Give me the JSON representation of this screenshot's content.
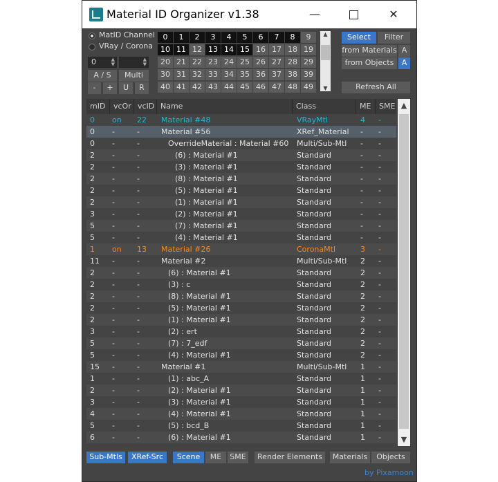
{
  "window": {
    "title": "Material ID Organizer v1.38",
    "icon": "3dsmax-app-icon",
    "minimize": "—",
    "close": "✕"
  },
  "channel": {
    "options": [
      "MatID Channel",
      "VRay / Corona"
    ],
    "selected": "MatID Channel",
    "spinner_value": "0",
    "spinner2_value": ""
  },
  "left_buttons": {
    "as": "A / S",
    "multi": "Multi",
    "minus": "-",
    "plus": "+",
    "u": "U",
    "r": "R"
  },
  "id_grid": {
    "rows": [
      [
        "0",
        "1",
        "2",
        "3",
        "4",
        "5",
        "6",
        "7",
        "8",
        "9"
      ],
      [
        "10",
        "11",
        "12",
        "13",
        "14",
        "15",
        "16",
        "17",
        "18",
        "19"
      ],
      [
        "20",
        "21",
        "22",
        "23",
        "24",
        "25",
        "26",
        "27",
        "28",
        "29"
      ],
      [
        "30",
        "31",
        "32",
        "33",
        "34",
        "35",
        "36",
        "37",
        "38",
        "39"
      ],
      [
        "40",
        "41",
        "42",
        "43",
        "44",
        "45",
        "46",
        "47",
        "48",
        "49"
      ]
    ],
    "used_ids": [
      "0",
      "1",
      "2",
      "3",
      "4",
      "5",
      "6",
      "7",
      "8",
      "10",
      "11",
      "13",
      "14",
      "15"
    ]
  },
  "right_buttons": {
    "select": "Select",
    "filter": "Filter",
    "from_materials": "from Materials",
    "from_objects": "from Objects",
    "a1": "A",
    "a2": "A",
    "refresh": "Refresh All"
  },
  "table": {
    "headers": [
      "mID",
      "vcOr",
      "vcID",
      "Name",
      "Class",
      "ME",
      "SME"
    ],
    "rows": [
      {
        "mid": "0",
        "vcor": "on",
        "vcid": "22",
        "name": "Material #48",
        "cls": "VRayMtl",
        "me": "4",
        "sme": "-",
        "style": "cyan",
        "indent": 0
      },
      {
        "mid": "0",
        "vcor": "-",
        "vcid": "-",
        "name": "Material #56",
        "cls": "XRef_Material",
        "me": "-",
        "sme": "-",
        "style": "sel",
        "indent": 0
      },
      {
        "mid": "0",
        "vcor": "-",
        "vcid": "-",
        "name": "OverrideMaterial : Material #60",
        "cls": "Multi/Sub-Mtl",
        "me": "-",
        "sme": "-",
        "style": "norm",
        "indent": 1
      },
      {
        "mid": "2",
        "vcor": "-",
        "vcid": "-",
        "name": "(6) : Material #1",
        "cls": "Standard",
        "me": "-",
        "sme": "-",
        "style": "norm",
        "indent": 2
      },
      {
        "mid": "2",
        "vcor": "-",
        "vcid": "-",
        "name": "(3) : Material #1",
        "cls": "Standard",
        "me": "-",
        "sme": "-",
        "style": "norm",
        "indent": 2
      },
      {
        "mid": "2",
        "vcor": "-",
        "vcid": "-",
        "name": "(8) : Material #1",
        "cls": "Standard",
        "me": "-",
        "sme": "-",
        "style": "norm",
        "indent": 2
      },
      {
        "mid": "2",
        "vcor": "-",
        "vcid": "-",
        "name": "(5) : Material #1",
        "cls": "Standard",
        "me": "-",
        "sme": "-",
        "style": "norm",
        "indent": 2
      },
      {
        "mid": "2",
        "vcor": "-",
        "vcid": "-",
        "name": "(1) : Material #1",
        "cls": "Standard",
        "me": "-",
        "sme": "-",
        "style": "norm",
        "indent": 2
      },
      {
        "mid": "3",
        "vcor": "-",
        "vcid": "-",
        "name": "(2) : Material #1",
        "cls": "Standard",
        "me": "-",
        "sme": "-",
        "style": "norm",
        "indent": 2
      },
      {
        "mid": "5",
        "vcor": "-",
        "vcid": "-",
        "name": "(7) : Material #1",
        "cls": "Standard",
        "me": "-",
        "sme": "-",
        "style": "norm",
        "indent": 2
      },
      {
        "mid": "5",
        "vcor": "-",
        "vcid": "-",
        "name": "(4) : Material #1",
        "cls": "Standard",
        "me": "-",
        "sme": "-",
        "style": "norm",
        "indent": 2
      },
      {
        "mid": "1",
        "vcor": "on",
        "vcid": "13",
        "name": "Material #26",
        "cls": "CoronaMtl",
        "me": "3",
        "sme": "-",
        "style": "orange",
        "indent": 0
      },
      {
        "mid": "11",
        "vcor": "-",
        "vcid": "-",
        "name": "Material #2",
        "cls": "Multi/Sub-Mtl",
        "me": "2",
        "sme": "-",
        "style": "norm",
        "indent": 0
      },
      {
        "mid": "2",
        "vcor": "-",
        "vcid": "-",
        "name": "(6) : Material #1",
        "cls": "Standard",
        "me": "2",
        "sme": "-",
        "style": "norm",
        "indent": 1
      },
      {
        "mid": "2",
        "vcor": "-",
        "vcid": "-",
        "name": "(3) : c",
        "cls": "Standard",
        "me": "2",
        "sme": "-",
        "style": "norm",
        "indent": 1
      },
      {
        "mid": "2",
        "vcor": "-",
        "vcid": "-",
        "name": "(8) : Material #1",
        "cls": "Standard",
        "me": "2",
        "sme": "-",
        "style": "norm",
        "indent": 1
      },
      {
        "mid": "2",
        "vcor": "-",
        "vcid": "-",
        "name": "(5) : Material #1",
        "cls": "Standard",
        "me": "2",
        "sme": "-",
        "style": "norm",
        "indent": 1
      },
      {
        "mid": "2",
        "vcor": "-",
        "vcid": "-",
        "name": "(1) : Material #1",
        "cls": "Standard",
        "me": "2",
        "sme": "-",
        "style": "norm",
        "indent": 1
      },
      {
        "mid": "3",
        "vcor": "-",
        "vcid": "-",
        "name": "(2) : ert",
        "cls": "Standard",
        "me": "2",
        "sme": "-",
        "style": "norm",
        "indent": 1
      },
      {
        "mid": "5",
        "vcor": "-",
        "vcid": "-",
        "name": "(7) : 7_edf",
        "cls": "Standard",
        "me": "2",
        "sme": "-",
        "style": "norm",
        "indent": 1
      },
      {
        "mid": "5",
        "vcor": "-",
        "vcid": "-",
        "name": "(4) : Material #1",
        "cls": "Standard",
        "me": "2",
        "sme": "-",
        "style": "norm",
        "indent": 1
      },
      {
        "mid": "15",
        "vcor": "-",
        "vcid": "-",
        "name": "Material #1",
        "cls": "Multi/Sub-Mtl",
        "me": "1",
        "sme": "-",
        "style": "norm",
        "indent": 0
      },
      {
        "mid": "1",
        "vcor": "-",
        "vcid": "-",
        "name": "(1) : abc_A",
        "cls": "Standard",
        "me": "1",
        "sme": "-",
        "style": "norm",
        "indent": 1
      },
      {
        "mid": "2",
        "vcor": "-",
        "vcid": "-",
        "name": "(2) : Material #1",
        "cls": "Standard",
        "me": "1",
        "sme": "-",
        "style": "norm",
        "indent": 1
      },
      {
        "mid": "3",
        "vcor": "-",
        "vcid": "-",
        "name": "(3) : Material #1",
        "cls": "Standard",
        "me": "1",
        "sme": "-",
        "style": "norm",
        "indent": 1
      },
      {
        "mid": "4",
        "vcor": "-",
        "vcid": "-",
        "name": "(4) : Material #1",
        "cls": "Standard",
        "me": "1",
        "sme": "-",
        "style": "norm",
        "indent": 1
      },
      {
        "mid": "5",
        "vcor": "-",
        "vcid": "-",
        "name": "(5) : bcd_B",
        "cls": "Standard",
        "me": "1",
        "sme": "-",
        "style": "norm",
        "indent": 1
      },
      {
        "mid": "6",
        "vcor": "-",
        "vcid": "-",
        "name": "(6) : Material #1",
        "cls": "Standard",
        "me": "1",
        "sme": "-",
        "style": "norm",
        "indent": 1
      }
    ]
  },
  "bottom": {
    "sub_mtls": "Sub-Mtls",
    "xref_src": "XRef-Src",
    "scene": "Scene",
    "me": "ME",
    "sme": "SME",
    "render_elements": "Render Elements",
    "materials": "Materials",
    "objects": "Objects",
    "credit": "by Pixamoon"
  },
  "colors": {
    "accent_blue": "#3b77c7",
    "cyan_row": "#1fb8d6",
    "orange_row": "#f58a1f",
    "panel_bg": "#444444"
  }
}
